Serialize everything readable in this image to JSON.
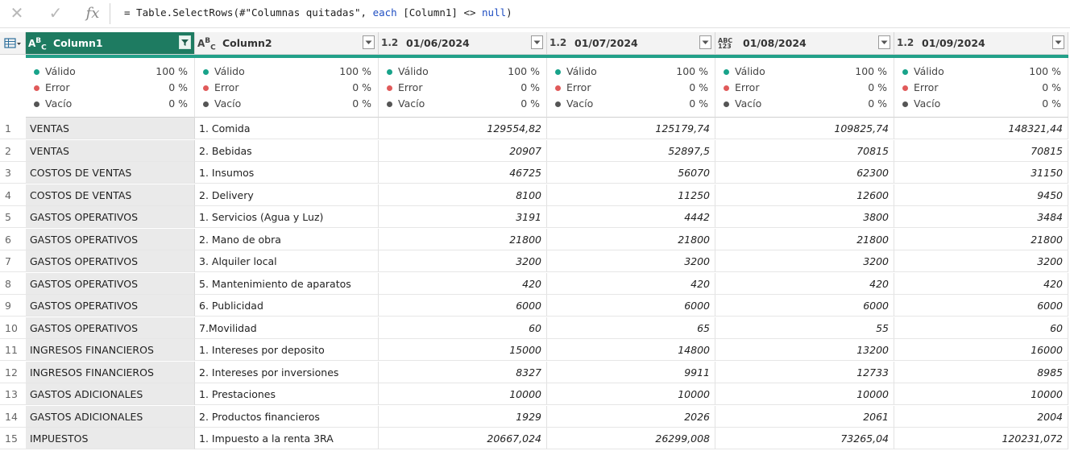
{
  "formula_bar": {
    "cancel_icon": "close-icon",
    "confirm_icon": "check-icon",
    "fx_label": "fx",
    "formula_prefix": "= Table.SelectRows(#\"Columnas quitadas\", ",
    "formula_keyword": "each",
    "formula_middle": " [Column1] <> ",
    "formula_null": "null",
    "formula_suffix": ")"
  },
  "columns": [
    {
      "type": "ABC",
      "name": "Column1",
      "selected": true,
      "filter": true
    },
    {
      "type": "ABC",
      "name": "Column2",
      "selected": false,
      "filter": false
    },
    {
      "type": "1.2",
      "name": "01/06/2024",
      "selected": false,
      "filter": false
    },
    {
      "type": "1.2",
      "name": "01/07/2024",
      "selected": false,
      "filter": false
    },
    {
      "type": "ABC123",
      "name": "01/08/2024",
      "selected": false,
      "filter": false
    },
    {
      "type": "1.2",
      "name": "01/09/2024",
      "selected": false,
      "filter": false
    }
  ],
  "quality": {
    "labels": [
      "Válido",
      "Error",
      "Vacío"
    ],
    "colors": [
      "#18a38a",
      "#e05a5a",
      "#555555"
    ],
    "values": [
      "100 %",
      "0 %",
      "0 %"
    ]
  },
  "rows": [
    [
      "1",
      "VENTAS",
      "1. Comida",
      "129554,82",
      "125179,74",
      "109825,74",
      "148321,44"
    ],
    [
      "2",
      "VENTAS",
      "2. Bebidas",
      "20907",
      "52897,5",
      "70815",
      "70815"
    ],
    [
      "3",
      "COSTOS DE VENTAS",
      "1. Insumos",
      "46725",
      "56070",
      "62300",
      "31150"
    ],
    [
      "4",
      "COSTOS DE VENTAS",
      "2. Delivery",
      "8100",
      "11250",
      "12600",
      "9450"
    ],
    [
      "5",
      "GASTOS OPERATIVOS",
      "1. Servicios (Agua y Luz)",
      "3191",
      "4442",
      "3800",
      "3484"
    ],
    [
      "6",
      "GASTOS OPERATIVOS",
      "2. Mano de obra",
      "21800",
      "21800",
      "21800",
      "21800"
    ],
    [
      "7",
      "GASTOS OPERATIVOS",
      "3. Alquiler local",
      "3200",
      "3200",
      "3200",
      "3200"
    ],
    [
      "8",
      "GASTOS OPERATIVOS",
      "5. Mantenimiento de aparatos",
      "420",
      "420",
      "420",
      "420"
    ],
    [
      "9",
      "GASTOS OPERATIVOS",
      "6. Publicidad",
      "6000",
      "6000",
      "6000",
      "6000"
    ],
    [
      "10",
      "GASTOS OPERATIVOS",
      "7.Movilidad",
      "60",
      "65",
      "55",
      "60"
    ],
    [
      "11",
      "INGRESOS FINANCIEROS",
      "1. Intereses por deposito",
      "15000",
      "14800",
      "13200",
      "16000"
    ],
    [
      "12",
      "INGRESOS FINANCIEROS",
      "2. Intereses por inversiones",
      "8327",
      "9911",
      "12733",
      "8985"
    ],
    [
      "13",
      "GASTOS ADICIONALES",
      "1. Prestaciones",
      "10000",
      "10000",
      "10000",
      "10000"
    ],
    [
      "14",
      "GASTOS ADICIONALES",
      "2. Productos financieros",
      "1929",
      "2026",
      "2061",
      "2004"
    ],
    [
      "15",
      "IMPUESTOS",
      "1. Impuesto a la renta 3RA",
      "20667,024",
      "26299,008",
      "73265,04",
      "120231,072"
    ]
  ]
}
